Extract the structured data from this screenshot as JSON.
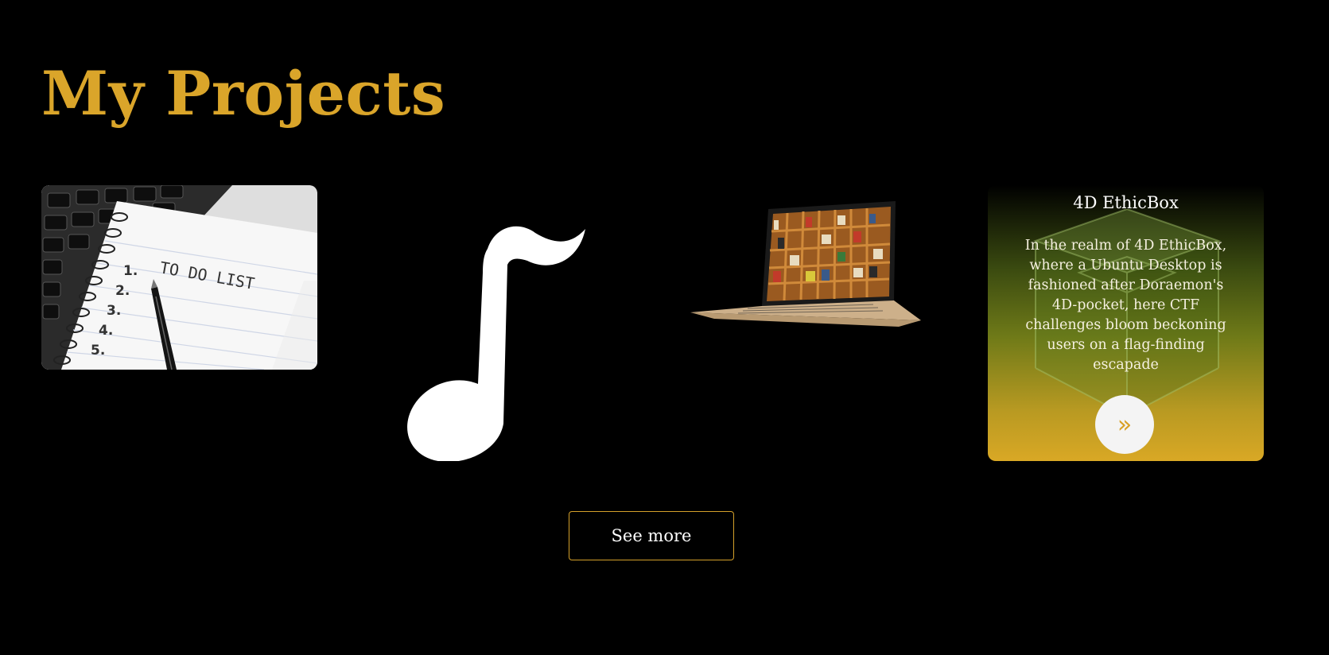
{
  "section": {
    "title": "My Projects"
  },
  "projects": [
    {
      "id": "todo-list",
      "image_icon": "todo-list-notebook-image",
      "image_text": "TO DO LIST",
      "list_numbers": [
        "1.",
        "2.",
        "3.",
        "4.",
        "5."
      ]
    },
    {
      "id": "music-player",
      "image_icon": "music-note-icon"
    },
    {
      "id": "library",
      "image_icon": "laptop-bookshelf-image"
    },
    {
      "id": "4d-ethicbox",
      "name": "4D EthicBox",
      "description": "In the realm of 4D EthicBox, where a Ubuntu Desktop is fashioned after Doraemon's 4D-pocket, here CTF challenges bloom beckoning users on a flag-finding escapade",
      "go_icon": "double-chevron-right-icon",
      "go_glyph": "»"
    }
  ],
  "see_more_label": "See more",
  "colors": {
    "accent": "#DAA52A",
    "background": "#000000",
    "text": "#FFFFFF"
  }
}
